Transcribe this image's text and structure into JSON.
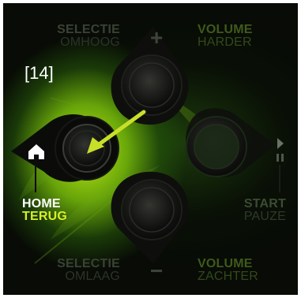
{
  "reference_label": "[14]",
  "labels": {
    "selection_up": {
      "line1": "SELECTIE",
      "line2": "OMHOOG"
    },
    "volume_up": {
      "line1": "VOLUME",
      "line2": "HARDER"
    },
    "home": {
      "line1": "HOME",
      "line2": "TERUG"
    },
    "start": {
      "line1": "START",
      "line2": "PAUZE"
    },
    "selection_down": {
      "line1": "SELECTIE",
      "line2": "OMLAAG"
    },
    "volume_down": {
      "line1": "VOLUME",
      "line2": "ZACHTER"
    }
  },
  "symbols": {
    "plus": "+",
    "minus": "−"
  },
  "icons": [
    "home-icon",
    "play-icon",
    "pause-icon"
  ],
  "colors": {
    "highlight_green": "#d6ee28",
    "arrow": "#c8df2a",
    "button_ring": "#1a1c18"
  }
}
